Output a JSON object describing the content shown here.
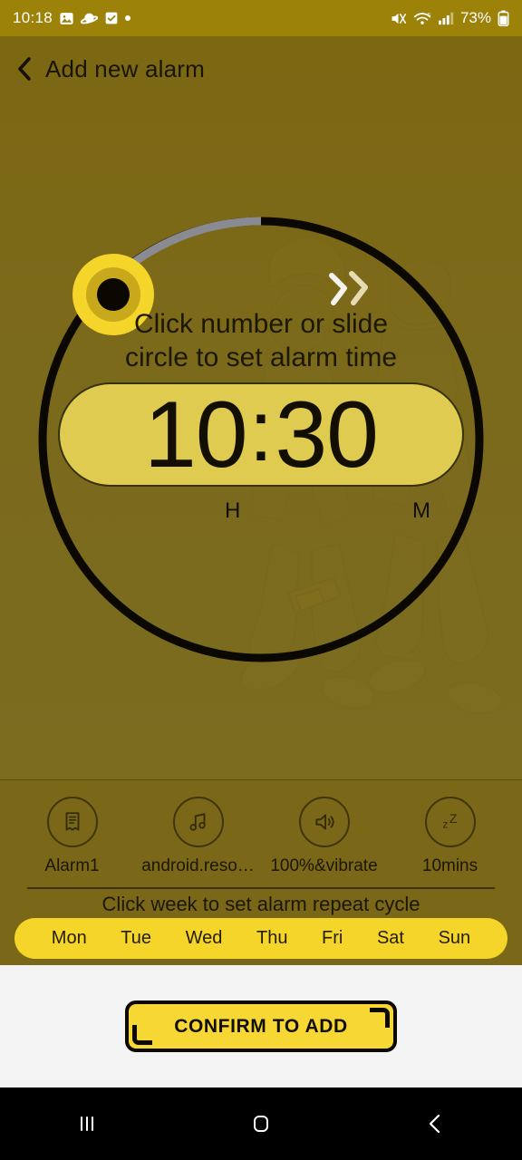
{
  "status_bar": {
    "time": "10:18",
    "battery_percent": "73%",
    "left_icons": [
      "image-icon",
      "planet-icon",
      "checkbox-icon",
      "dot-icon"
    ],
    "right_icons": [
      "mute-vibrate-icon",
      "wifi-icon",
      "cellular-signal-icon",
      "battery-icon"
    ]
  },
  "header": {
    "back_icon": "back-chevron-icon",
    "title": "Add new alarm"
  },
  "dial": {
    "hint_line1": "Click number or slide",
    "hint_line2": "circle to set alarm time",
    "hour": "10",
    "colon": ":",
    "minute": "30",
    "hour_label": "H",
    "minute_label": "M",
    "handle_icon": "dial-handle-knob",
    "arrow_icon": "double-chevron-icon",
    "track_color": "#0a0800",
    "progress_color": "#8a8a92",
    "knob_color": "#f5d52a",
    "pill_color": "#f7e35c"
  },
  "options": [
    {
      "icon": "alarm-label-icon",
      "label": "Alarm1"
    },
    {
      "icon": "music-note-icon",
      "label": "android.reso…"
    },
    {
      "icon": "volume-icon",
      "label": "100%&vibrate"
    },
    {
      "icon": "snooze-zz-icon",
      "label": "10mins"
    }
  ],
  "week": {
    "hint": "Click week to set alarm repeat cycle",
    "days": [
      "Mon",
      "Tue",
      "Wed",
      "Thu",
      "Fri",
      "Sat",
      "Sun"
    ],
    "pill_color": "#f5d52a"
  },
  "footer": {
    "confirm_label": "CONFIRM TO ADD",
    "button_color": "#f7d734"
  },
  "nav_bar": {
    "recents_icon": "recents-icon",
    "home_icon": "home-icon",
    "back_icon": "nav-back-icon"
  }
}
